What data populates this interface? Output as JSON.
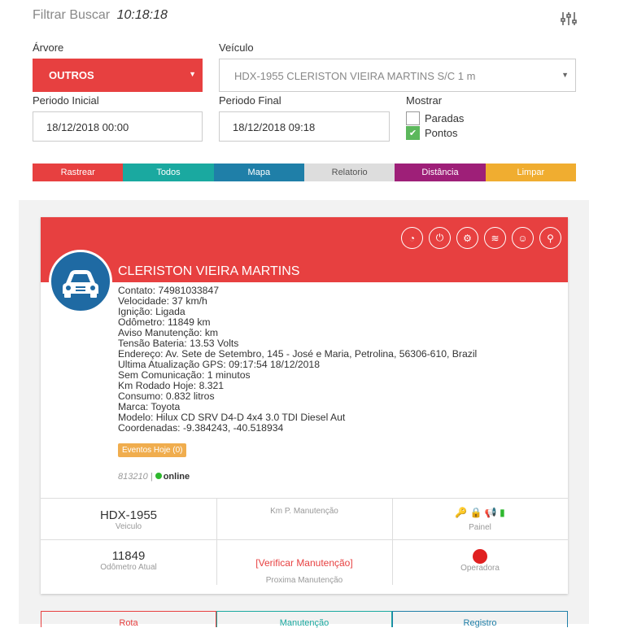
{
  "header": {
    "title": "Filtrar Buscar",
    "time": "10:18:18"
  },
  "form": {
    "arvore_label": "Árvore",
    "arvore_value": "OUTROS",
    "veiculo_label": "Veículo",
    "veiculo_value": "HDX-1955 CLERISTON VIEIRA MARTINS S/C 1 m",
    "periodo_inicial_label": "Periodo Inicial",
    "periodo_inicial_value": "18/12/2018 00:00",
    "periodo_final_label": "Periodo Final",
    "periodo_final_value": "18/12/2018 09:18",
    "mostrar_label": "Mostrar",
    "paradas_label": "Paradas",
    "pontos_label": "Pontos"
  },
  "actions": [
    {
      "label": "Rastrear",
      "color": "#e74040"
    },
    {
      "label": "Todos",
      "color": "#1aa9a0"
    },
    {
      "label": "Mapa",
      "color": "#1f7fa8"
    },
    {
      "label": "Relatorio",
      "color": "#dddddd"
    },
    {
      "label": "Distância",
      "color": "#9e1f78"
    },
    {
      "label": "Limpar",
      "color": "#f0ad30"
    }
  ],
  "card": {
    "name": "CLERISTON VIEIRA MARTINS",
    "details": [
      "Contato: 74981033847",
      "Velocidade: 37 km/h",
      "Ignição: Ligada",
      "Odômetro: 11849 km",
      "Aviso Manutenção: km",
      "Tensão Bateria: 13.53 Volts",
      "Endereço: Av. Sete de Setembro, 145 - José e Maria, Petrolina, 56306-610, Brazil",
      "Ultima Atualização GPS: 09:17:54 18/12/2018",
      "Sem Comunicação: 1 minutos",
      "Km Rodado Hoje: 8.321",
      "Consumo: 0.832 litros",
      "Marca: Toyota",
      "Modelo: Hilux CD SRV D4-D 4x4 3.0 TDI Diesel Aut",
      "Coordenadas: -9.384243, -40.518934"
    ],
    "events_badge": "Eventos Hoje (0)",
    "device_id": "813210",
    "separator": "|",
    "status": "online",
    "grid": {
      "plate": "HDX-1955",
      "plate_label": "Veiculo",
      "km_label": "Km P. Manutenção",
      "panel_label": "Painel",
      "odometer": "11849",
      "odometer_label": "Odômetro Atual",
      "maintenance_link": "[Verificar Manutenção]",
      "maintenance_label": "Proxima Manutenção",
      "operator_label": "Operadora"
    }
  },
  "bottom_tabs": [
    {
      "label": "Rota",
      "color": "#e74040"
    },
    {
      "label": "Manutenção",
      "color": "#1aa9a0"
    },
    {
      "label": "Registro",
      "color": "#1f7fa8"
    }
  ]
}
